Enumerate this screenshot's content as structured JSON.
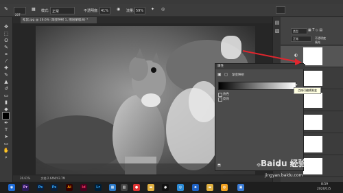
{
  "options_bar": {
    "mode_label": "模式:",
    "mode_value": "正常",
    "opacity_label": "不透明度:",
    "opacity_value": "41%",
    "flow_label": "流量:",
    "flow_value": "59%",
    "brush_size": "207"
  },
  "document": {
    "tab_title": "松鼠.jpg @ 26.6% (渐变映射 1, 图层蒙版/8) *",
    "zoom": "26.61%",
    "doc_info": "文档:2.64M/43.7M"
  },
  "layers_panel": {
    "kind_label": "类型",
    "blend_mode": "正常",
    "opacity_short": "不透明度",
    "fill_short": "填充"
  },
  "gradient_dialog": {
    "title": "属性",
    "adjustment_name": "渐变映射",
    "option_dither": "仿色",
    "option_reverse": "反向"
  },
  "tooltip": {
    "text": "点按可编辑渐变"
  },
  "watermark": {
    "text": "Baidu 经验",
    "url": "jingyan.baidu.com"
  },
  "taskbar": {
    "icons": [
      "pr-icon",
      "ps-icon",
      "ps-icon",
      "ai-icon",
      "id-icon",
      "lr-icon",
      "explorer-icon",
      "chrome-icon",
      "folder-icon",
      "qq-icon",
      "browser-icon",
      "ie-icon",
      "folder-icon",
      "wechat-icon",
      "photos-icon"
    ],
    "time": "8:59",
    "date": "2020/1/5"
  },
  "colors": {
    "accent_red": "#e0262e",
    "panel_bg": "#3c3c3c"
  }
}
